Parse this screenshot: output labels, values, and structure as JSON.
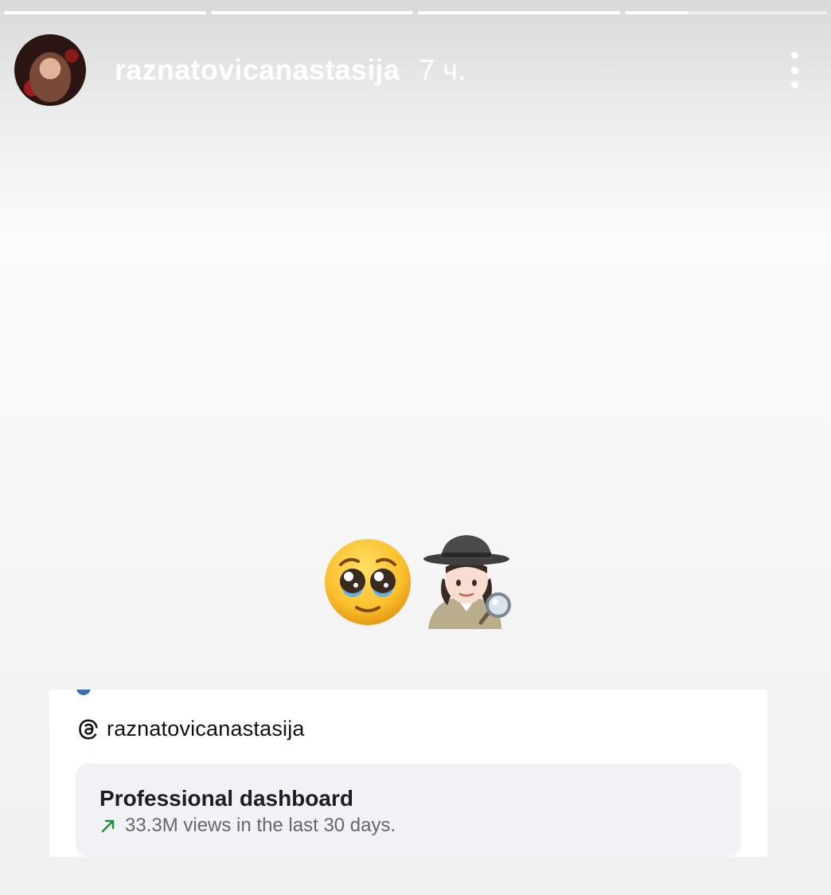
{
  "story": {
    "progress_segments": [
      {
        "state": "complete",
        "fill": 1.0
      },
      {
        "state": "complete",
        "fill": 1.0
      },
      {
        "state": "complete",
        "fill": 1.0
      },
      {
        "state": "current",
        "fill": 0.31
      }
    ],
    "header": {
      "username": "raznatovicanastasija",
      "time": "7 ч.",
      "more_icon": "vertical-ellipsis-icon"
    },
    "stickers": [
      {
        "name": "pleading-face-emoji",
        "emoji": "🥺"
      },
      {
        "name": "woman-detective-emoji",
        "emoji": "🕵️‍♀️"
      }
    ]
  },
  "card": {
    "threads_icon": "threads-logo-icon",
    "threads_username": "raznatovicanastasija",
    "dashboard": {
      "title": "Professional dashboard",
      "trend_icon": "trending-up-arrow-icon",
      "trend_color": "#1e8e3e",
      "subtitle": "33.3M views in the last 30 days."
    }
  }
}
